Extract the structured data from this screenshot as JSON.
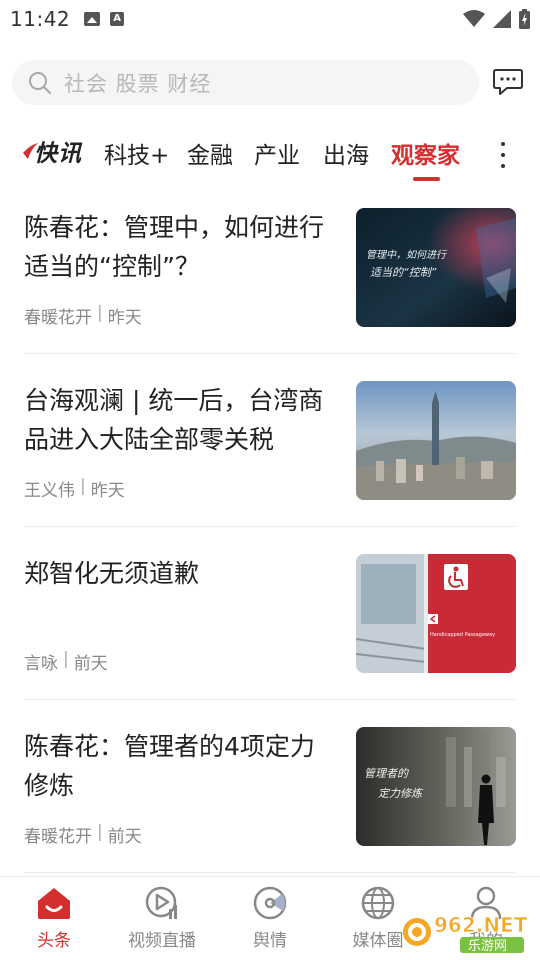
{
  "status_bar": {
    "time": "11:42",
    "icons": [
      "image-icon",
      "a-icon",
      "wifi-icon",
      "signal-icon",
      "battery-icon"
    ]
  },
  "search": {
    "placeholder": "社会 股票 财经"
  },
  "tabs": {
    "logo_text": "快讯",
    "items": [
      {
        "label": "科技+"
      },
      {
        "label": "金融"
      },
      {
        "label": "产业"
      },
      {
        "label": "出海"
      },
      {
        "label": "观察家",
        "active": true
      }
    ]
  },
  "news": [
    {
      "title": "陈春花：管理中，如何进行适当的“控制”？",
      "author": "春暖花开",
      "time": "昨天",
      "thumb_caption": "管理中，如何进行适当的“控制”"
    },
    {
      "title": "台海观澜 | 统一后，台湾商品进入大陆全部零关税",
      "author": "王义伟",
      "time": "昨天"
    },
    {
      "title": "郑智化无须道歉",
      "author": "言咏",
      "time": "前天",
      "thumb_caption": "Handicapped Passageway"
    },
    {
      "title": "陈春花：管理者的4项定力修炼",
      "author": "春暖花开",
      "time": "前天",
      "thumb_caption": "管理者的定力修炼"
    }
  ],
  "bottom_nav": [
    {
      "label": "头条",
      "icon": "home-icon",
      "active": true
    },
    {
      "label": "视频直播",
      "icon": "video-play-icon"
    },
    {
      "label": "舆情",
      "icon": "radar-icon"
    },
    {
      "label": "媒体圈",
      "icon": "globe-icon"
    },
    {
      "label": "我的",
      "icon": "user-icon"
    }
  ],
  "watermark": {
    "brand": "962.NET",
    "sub": "乐游网"
  },
  "colors": {
    "accent": "#d42f2f",
    "text_primary": "#222222",
    "text_secondary": "#888888",
    "search_bg": "#f5f5f5"
  }
}
